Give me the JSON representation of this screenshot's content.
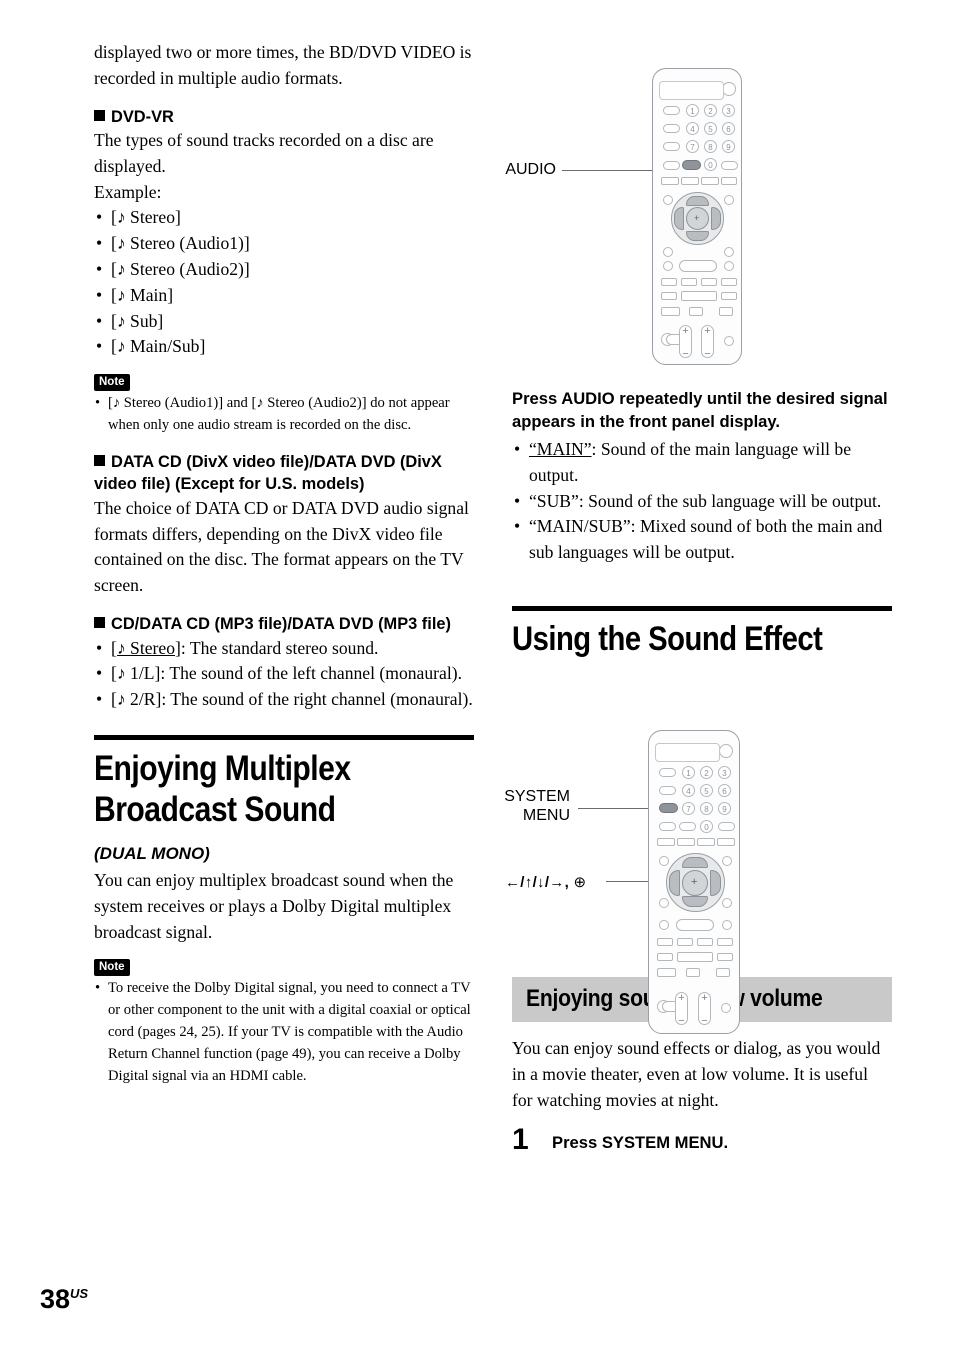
{
  "page": {
    "number": "38",
    "region": "US"
  },
  "left_column": {
    "intro_paragraph": "displayed two or more times, the BD/DVD VIDEO is recorded in multiple audio formats.",
    "dvdvr": {
      "heading": "DVD-VR",
      "paragraph": "The types of sound tracks recorded on a disc are displayed.",
      "example_label": "Example:",
      "items": [
        "[♪ Stereo]",
        "[♪ Stereo (Audio1)]",
        "[♪ Stereo (Audio2)]",
        "[♪ Main]",
        "[♪ Sub]",
        "[♪ Main/Sub]"
      ]
    },
    "note1": {
      "label": "Note",
      "items": [
        "[♪ Stereo (Audio1)] and [♪ Stereo (Audio2)] do not appear when only one audio stream is recorded on the disc."
      ]
    },
    "divx": {
      "heading": "DATA CD (DivX video file)/DATA DVD (DivX video file) (Except for U.S. models)",
      "paragraph": "The choice of DATA CD or DATA DVD audio signal formats differs, depending on the DivX video file contained on the disc. The format appears on the TV screen."
    },
    "mp3": {
      "heading": "CD/DATA CD (MP3 file)/DATA DVD (MP3 file)",
      "items": [
        {
          "term": "[♪ Stereo]",
          "underline": true,
          "desc": ": The standard stereo sound."
        },
        {
          "term": "[♪ 1/L]",
          "underline": false,
          "desc": ": The sound of the left channel (monaural)."
        },
        {
          "term": "[♪ 2/R]",
          "underline": false,
          "desc": ": The sound of the right channel (monaural)."
        }
      ]
    },
    "chapter": {
      "title": "Enjoying Multiplex\nBroadcast Sound",
      "subtitle": "(DUAL MONO)",
      "paragraph": "You can enjoy multiplex broadcast sound when the system receives or plays a Dolby Digital multiplex broadcast signal."
    },
    "note2": {
      "label": "Note",
      "items": [
        "To receive the Dolby Digital signal, you need to connect a TV or other component to the unit with a digital coaxial or optical cord (pages 24, 25). If your TV is compatible with the Audio Return Channel function (page 49), you can receive a Dolby Digital signal via an HDMI cable."
      ]
    }
  },
  "right_column": {
    "remote_top": {
      "callout_audio": "AUDIO",
      "keypad_digits": [
        "1",
        "2",
        "3",
        "4",
        "5",
        "6",
        "7",
        "8",
        "9",
        "0"
      ]
    },
    "audio_instruction": "Press AUDIO repeatedly until the desired signal appears in the front panel display.",
    "audio_items": [
      {
        "term": "“MAIN”",
        "underline": true,
        "desc": ": Sound of the main language will be output."
      },
      {
        "term": "“SUB”",
        "underline": false,
        "desc": ": Sound of the sub language will be output."
      },
      {
        "term": "“MAIN/SUB”",
        "underline": false,
        "desc": ": Mixed sound of both the main and sub languages will be output."
      }
    ],
    "chapter": {
      "title": "Using the Sound Effect"
    },
    "remote_bottom": {
      "callout_system_menu_line1": "SYSTEM",
      "callout_system_menu_line2": "MENU",
      "callout_arrows": "←/↑/↓/→,",
      "callout_enter_icon": "enter-button-icon",
      "keypad_digits": [
        "1",
        "2",
        "3",
        "4",
        "5",
        "6",
        "7",
        "8",
        "9",
        "0"
      ]
    },
    "gray_heading": "Enjoying sound at low volume",
    "low_volume_paragraph": "You can enjoy sound effects or dialog, as you would in a movie theater, even at low volume. It is useful for watching movies at night.",
    "step1": {
      "number": "1",
      "text": "Press SYSTEM MENU."
    }
  },
  "colors": {
    "gray_band": "#c9c9c9",
    "remote_outline": "#9aa0a6",
    "highlight": "#8e9499"
  }
}
